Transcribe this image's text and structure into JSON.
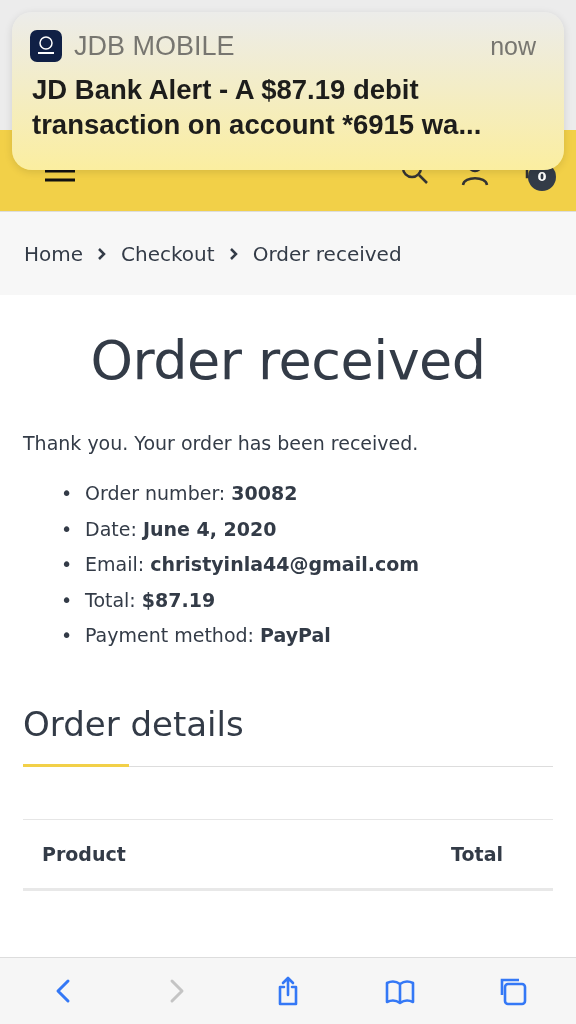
{
  "notification": {
    "app": "JDB MOBILE",
    "time": "now",
    "message": "JD Bank Alert - A $87.19 debit transaction on account *6915 wa..."
  },
  "header": {
    "cart_count": "0"
  },
  "breadcrumb": [
    {
      "label": "Home"
    },
    {
      "label": "Checkout"
    },
    {
      "label": "Order received"
    }
  ],
  "title": "Order received",
  "thanks": "Thank you. Your order has been received.",
  "order_summary": [
    {
      "marker": "•",
      "label": "Order number:",
      "value": "30082"
    },
    {
      "marker": "•",
      "label": "Date:",
      "value": "June 4, 2020"
    },
    {
      "marker": "•",
      "label": "Email:",
      "value": "christyinla44@gmail.com"
    },
    {
      "marker": "•",
      "label": "Total:",
      "value": "$87.19"
    },
    {
      "marker": "•",
      "label": "Payment method:",
      "value": "PayPal"
    }
  ],
  "details": {
    "heading": "Order details",
    "table": {
      "columns": [
        "Product",
        "Total"
      ]
    }
  },
  "browser_toolbar": [
    {
      "kind": "back",
      "disabled": false
    },
    {
      "kind": "forward",
      "disabled": true
    },
    {
      "kind": "share",
      "disabled": false
    },
    {
      "kind": "bookmarks",
      "disabled": false
    },
    {
      "kind": "tabs",
      "disabled": false
    }
  ]
}
